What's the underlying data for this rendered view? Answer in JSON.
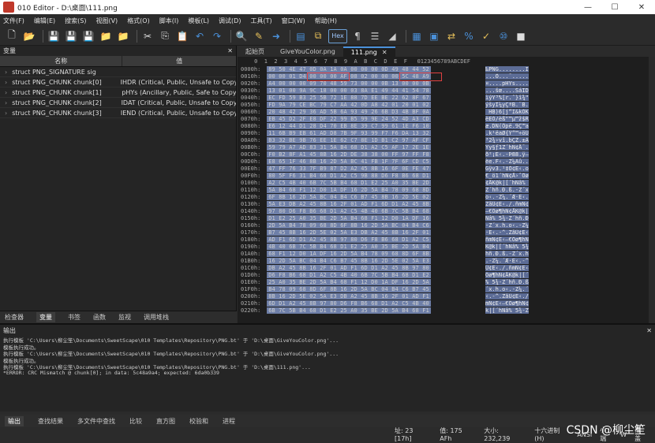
{
  "window": {
    "title": "010 Editor - D:\\桌面\\111.png",
    "minimize": "—",
    "maximize": "☐",
    "close": "✕"
  },
  "menu": [
    "文件(F)",
    "编辑(E)",
    "搜索(S)",
    "视图(V)",
    "格式(O)",
    "脚本(I)",
    "模板(L)",
    "调试(D)",
    "工具(T)",
    "窗口(W)",
    "帮助(H)"
  ],
  "toolbar": {
    "hex_label": "Hex"
  },
  "variables_panel": {
    "title": "变量",
    "close": "✕",
    "columns": {
      "name": "名称",
      "value": "值"
    },
    "rows": [
      {
        "name": "struct PNG_SIGNATURE sig",
        "value": ""
      },
      {
        "name": "struct PNG_CHUNK chunk[0]",
        "value": "IHDR  (Critical, Public, Unsafe to Copy)"
      },
      {
        "name": "struct PNG_CHUNK chunk[1]",
        "value": "pHYs  (Ancillary, Public, Safe to Copy)"
      },
      {
        "name": "struct PNG_CHUNK chunk[2]",
        "value": "IDAT  (Critical, Public, Unsafe to Copy)"
      },
      {
        "name": "struct PNG_CHUNK chunk[3]",
        "value": "IEND  (Critical, Public, Unsafe to Copy)"
      }
    ],
    "tabs": [
      "检查器",
      "变量",
      "书签",
      "函数",
      "监视",
      "调用堆栈"
    ]
  },
  "editor": {
    "tabs": [
      {
        "label": "起始页"
      },
      {
        "label": "GiveYouColor.png"
      },
      {
        "label": "111.png",
        "close": "✕"
      }
    ],
    "header": "     0  1  2  3  4  5  6  7  8  9  A  B  C  D  E  F   0123456789ABCDEF",
    "rows": [
      {
        "addr": "0000h:",
        "bytes": "89 50 4E 47 0D 0A 1A 0A 00 00 00 0D 49 48 44 52",
        "ascii": "‰PNG........IHDR"
      },
      {
        "addr": "0010h:",
        "bytes": "00 00 01 D4 00 00 00 AF 08 02 00 00 00 5C 48 A9",
        "ascii": "...Ô...¯.....\\H©"
      },
      {
        "addr": "0020h:",
        "bytes": "A4 00 00 00 09 70 48 59 73 00 00 0B 13 00 00 0B",
        "ascii": "¤....pHYs......."
      },
      {
        "addr": "0030h:",
        "bytes": "13 01 00 9A 9C 18 00 00 03 8A E1 49 44 41 54 78",
        "ascii": "...šœ....ŠáIDATx"
      },
      {
        "addr": "0040h:",
        "bytes": "EC FD 59 B3 25 5B 72 1E 88 7D EE BE 22 62 8F 67",
        "ascii": "ìýY³%[r.ˆ}î¾\"b.g"
      },
      {
        "addr": "0050h:",
        "bytes": "FD 9A 79 CE BC 79 C7 AA 42 0D A8 42 01 20 01 02",
        "ascii": "ýšyÎ¼yÇªB.¨B. .."
      },
      {
        "addr": "0060h:",
        "bytes": "20 48 42 29 36 AD 5B 6A 93 49 26 6B D3 4B BF 0A",
        "ascii": " HB)6­[j“I&kÓK¿."
      },
      {
        "addr": "0070h:",
        "bytes": "EB 45 D2 2F E8 DF 22 99 B5 99 9E 24 52 4D A3 CD",
        "ascii": "ëEÒ/èß\"™µ™ž$RM£Í"
      },
      {
        "addr": "0080h:",
        "bytes": "E6 12 44 D1 28 D4 70 EB 8E 39 C7 99 61 1E F6 10",
        "ascii": "æ.DÑ(Ôpë.9Ç™a.ö."
      },
      {
        "addr": "0090h:",
        "bytes": "11 6B B9 EB 61 AD D8 7B 9F 93 99 F7 F6 DA 13 32",
        "ascii": ".k¹ëa­Ø{Ÿ“™÷öÚ.2"
      },
      {
        "addr": "00A0h:",
        "bytes": "B3 32 BE 9B 76 EE 1E 62 C7 8E 1D B1 C2 97 AF CF",
        "ascii": "³2¾›vî.bÇŽ.±Â—¯Ï"
      },
      {
        "addr": "00B0h:",
        "bytes": "59 79 A7 AD 83 31 5A B4 68 D1 A2 C5 AF 17 2E 1E",
        "ascii": "Yy§­ƒ1Z´hÑ¢Å¯..."
      },
      {
        "addr": "00C0h:",
        "bytes": "F0 B2 8F A1 45 8B 16 2D DE 38 38 00 FF 97 FF F8",
        "ascii": "ð²¡E‹.-Þ88.ÿ—ÿø"
      },
      {
        "addr": "00D0h:",
        "bytes": "E8 65 1F 46 8B 16 2D 5A BC 41 FB 1F 7F 6F CD C5",
        "ascii": "èe.F‹.-Z¼Aû..oÍÅ"
      },
      {
        "addr": "00E0h:",
        "bytes": "47 FF 76 33 7F B9 87 D2 A2 45 8B 16 6F 0E FE 47",
        "ascii": "Gÿv3.¹‡Ò¢E‹.o.þG"
      },
      {
        "addr": "00F0h:",
        "bytes": "80 5F F6 31 B4 68 D1 A2 C5 9B 88 D6 F8 B6 68 D1",
        "ascii": "€_ö1´hÑ¢Å›ˆÖø¶hÑ"
      },
      {
        "addr": "0100h:",
        "bytes": "A2 C5 4B 40 6B 7C 5B B4 68 D1 E2 25 A0 35 BE 2D",
        "ascii": "¢ÅK@k|[´hÑâ% 5¾-"
      },
      {
        "addr": "0110h:",
        "bytes": "5A B4 68 F1 12 D0 1A DF 16 2D 5A B4 78 09 68 8D",
        "ascii": "Z´hñ.Ð.ß.-Z´x.h."
      },
      {
        "addr": "0120h:",
        "bytes": "6F 8B 16 2D 5A BC 04 B4 C6 B7 45 8B 16 2D 5E 02",
        "ascii": "o‹.-Z¼.´Æ·E‹.-^."
      },
      {
        "addr": "0130h:",
        "bytes": "5A E3 DB A2 45 8B 16 2F 01 AD F1 6D D1 A2 45 8B",
        "ascii": "ZãÛ¢E‹./.­ñmÑ¢E‹"
      },
      {
        "addr": "0140h:",
        "bytes": "97 80 D6 F8 B6 68 D1 A2 C5 4B 40 6B 7C 5B B4 68",
        "ascii": "—€Öø¶hÑ¢ÅK@k|[´h"
      },
      {
        "addr": "0150h:",
        "bytes": "D1 E2 25 A0 35 BE 2D 5A B4 68 F1 12 D0 1A DF 16",
        "ascii": "Ñâ% 5¾-Z´hñ.Ð.ß."
      },
      {
        "addr": "0160h:",
        "bytes": "2D 5A B4 78 09 68 8D 6F 8B 16 2D 5A BC 04 B4 C6",
        "ascii": "-Z´x.h.o‹.-Z¼.´Æ"
      },
      {
        "addr": "0170h:",
        "bytes": "B7 45 8B 16 2D 5E 02 5A E3 DB A2 45 8B 16 2F 01",
        "ascii": "·E‹.-^.ZãÛ¢E‹./."
      },
      {
        "addr": "0180h:",
        "bytes": "AD F1 6D D1 A2 45 8B 97 80 D6 F8 B6 68 D1 A2 C5",
        "ascii": "­ñmÑ¢E‹—€Öø¶hÑ¢Å"
      },
      {
        "addr": "0190h:",
        "bytes": "4B 40 6B 7C 5B B4 68 D1 E2 25 A0 35 BE 2D 5A B4",
        "ascii": "K@k|[´hÑâ% 5¾-Z´"
      },
      {
        "addr": "01A0h:",
        "bytes": "68 F1 12 D0 1A DF 16 2D 5A B4 78 09 68 8D 6F 8B",
        "ascii": "hñ.Ð.ß.-Z´x.h.o‹"
      },
      {
        "addr": "01B0h:",
        "bytes": "16 2D 5A BC 04 B4 C6 B7 45 8B 16 2D 5E 02 5A E3",
        "ascii": ".-Z¼.´Æ·E‹.-^.Zã"
      },
      {
        "addr": "01C0h:",
        "bytes": "DB A2 45 8B 16 2F 01 AD F1 6D D1 A2 45 8B 97 80",
        "ascii": "Û¢E‹./.­ñmÑ¢E‹—€"
      },
      {
        "addr": "01D0h:",
        "bytes": "D6 F8 B6 68 D1 A2 C5 4B 40 6B 7C 5B B4 68 D1 E2",
        "ascii": "Öø¶hÑ¢ÅK@k|[´hÑâ"
      },
      {
        "addr": "01E0h:",
        "bytes": "25 A0 35 BE 2D 5A B4 68 F1 12 D0 1A DF 16 2D 5A",
        "ascii": "% 5¾-Z´hñ.Ð.ß.-Z"
      },
      {
        "addr": "01F0h:",
        "bytes": "B4 78 09 68 8D 6F 8B 16 2D 5A BC 04 B4 C6 B7 45",
        "ascii": "´x.h.o‹.-Z¼.´Æ·E"
      },
      {
        "addr": "0200h:",
        "bytes": "8B 16 2D 5E 02 5A E3 DB A2 45 8B 16 2F 01 AD F1",
        "ascii": "‹.-^.ZãÛ¢E‹./.­ñ"
      },
      {
        "addr": "0210h:",
        "bytes": "6D D1 A2 45 8B 97 80 D6 F8 B6 68 D1 A2 C5 4B 40",
        "ascii": "mÑ¢E‹—€Öø¶hÑ¢ÅK@"
      },
      {
        "addr": "0220h:",
        "bytes": "6B 7C 5B B4 68 D1 E2 25 A0 35 BE 2D 5A B4 68 F1",
        "ascii": "k|[´hÑâ% 5¾-Z´hñ"
      }
    ]
  },
  "output": {
    "title": "输出",
    "close": "✕",
    "lines": [
      "执行模板 'C:\\Users\\柳尘笙\\Documents\\SweetScape\\010 Templates\\Repository\\PNG.bt' 于 'D:\\桌面\\GiveYouColor.png'...",
      "模板执行成功。",
      "执行模板 'C:\\Users\\柳尘笙\\Documents\\SweetScape\\010 Templates\\Repository\\PNG.bt' 于 'D:\\桌面\\GiveYouColor.png'...",
      "模板执行成功。",
      "执行模板 'C:\\Users\\柳尘笙\\Documents\\SweetScape\\010 Templates\\Repository\\PNG.bt' 于 'D:\\桌面\\111.png'...",
      "*ERROR: CRC Mismatch @ chunk[0]; in data: 5c48a9a4; expected: 6da0b339"
    ],
    "tabs": [
      "输出",
      "查找结果",
      "多文件中查找",
      "比较",
      "直方图",
      "校验和",
      "进程"
    ]
  },
  "status": {
    "position": "址: 23 [17h]",
    "value": "值: 175 AFh",
    "size": "大小: 232,239",
    "encoding": "十六进制(H)",
    "charset": "ANSI",
    "endian": "小端",
    "mode": "W",
    "insert": "覆盖"
  },
  "watermark": "CSDN @柳尘笙"
}
